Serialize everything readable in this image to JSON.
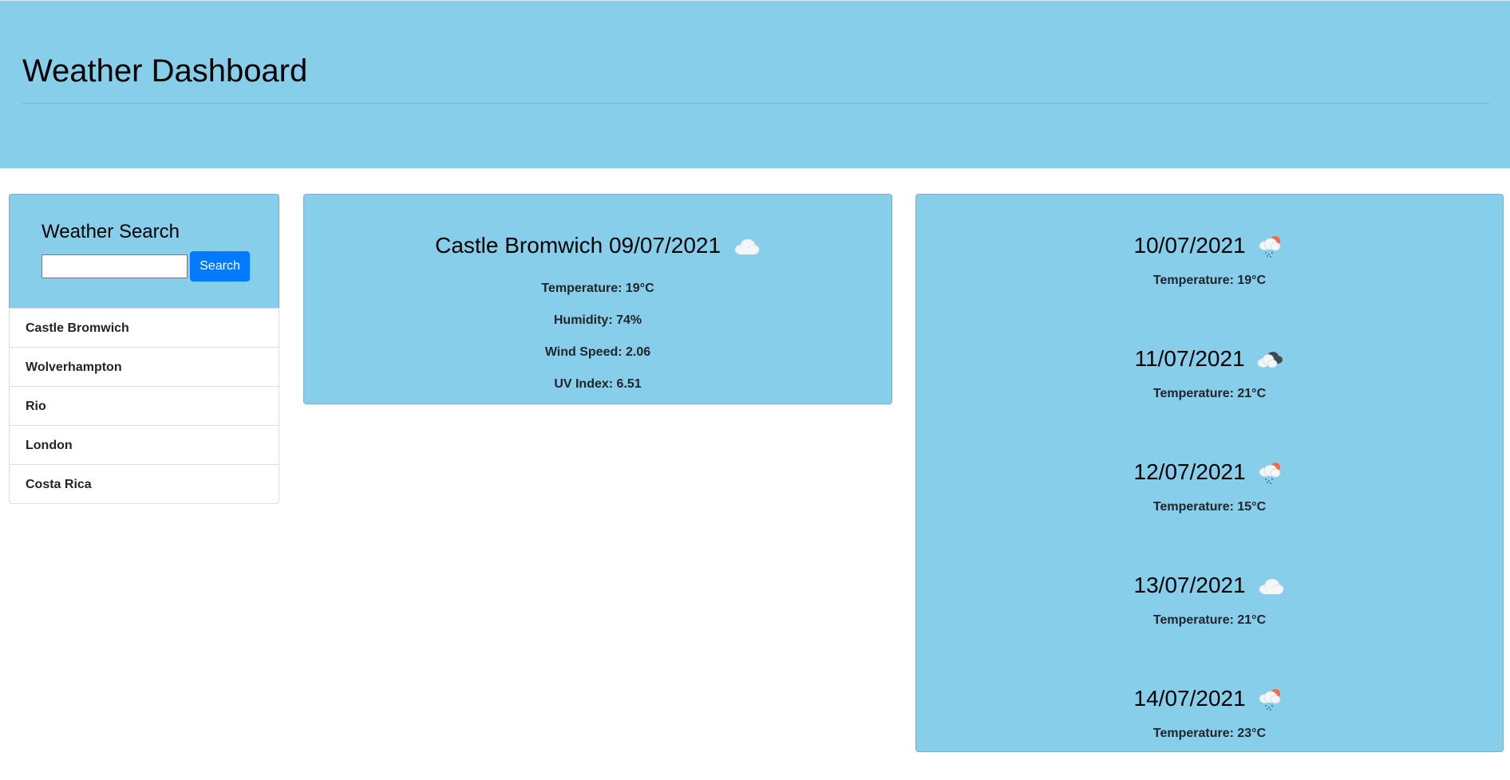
{
  "header": {
    "title": "Weather Dashboard"
  },
  "search": {
    "title": "Weather Search",
    "input_value": "",
    "button_label": "Search"
  },
  "history": [
    "Castle Bromwich",
    "Wolverhampton",
    "Rio",
    "London",
    "Costa Rica"
  ],
  "current": {
    "title": "Castle Bromwich 09/07/2021",
    "icon": "cloud-icon",
    "temperature": "Temperature: 19°C",
    "humidity": "Humidity: 74%",
    "wind": "Wind Speed: 2.06",
    "uv": "UV Index: 6.51"
  },
  "forecast": [
    {
      "date": "10/07/2021",
      "icon": "sun-rain-cloud-icon",
      "temp": "Temperature: 19°C"
    },
    {
      "date": "11/07/2021",
      "icon": "broken-clouds-icon",
      "temp": "Temperature: 21°C"
    },
    {
      "date": "12/07/2021",
      "icon": "sun-rain-cloud-icon",
      "temp": "Temperature: 15°C"
    },
    {
      "date": "13/07/2021",
      "icon": "cloud-icon",
      "temp": "Temperature: 21°C"
    },
    {
      "date": "14/07/2021",
      "icon": "sun-rain-cloud-icon",
      "temp": "Temperature: 23°C"
    }
  ],
  "colors": {
    "panel": "#87ceeb",
    "button": "#007bff"
  }
}
